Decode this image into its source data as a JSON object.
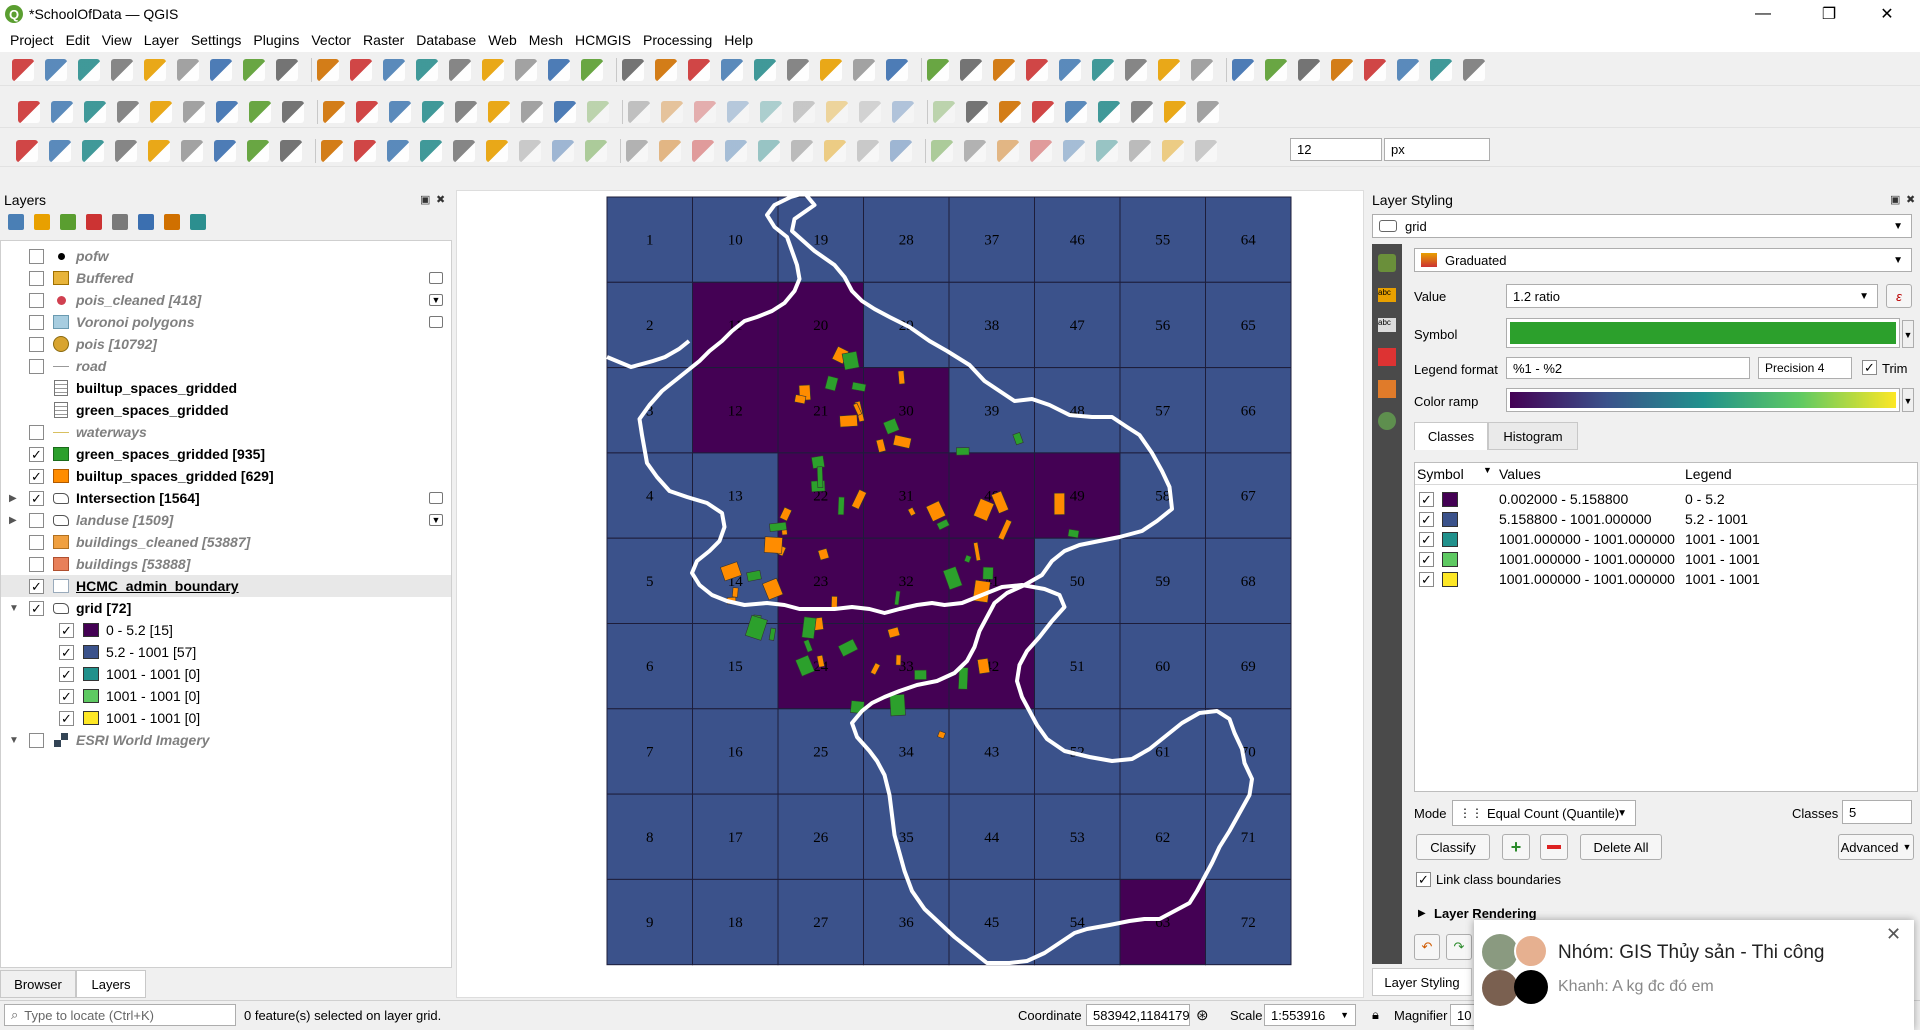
{
  "window": {
    "title": "*SchoolOfData — QGIS",
    "minimize": "—",
    "maximize": "❐",
    "close": "✕"
  },
  "menu": [
    "Project",
    "Edit",
    "View",
    "Layer",
    "Settings",
    "Plugins",
    "Vector",
    "Raster",
    "Database",
    "Web",
    "Mesh",
    "HCMGIS",
    "Processing",
    "Help"
  ],
  "digitize": {
    "size_value": "12",
    "unit": "px"
  },
  "layers_panel": {
    "title": "Layers",
    "items": [
      {
        "label": "pofw",
        "checked": false,
        "style": "it",
        "icon": "dot"
      },
      {
        "label": "Buffered",
        "checked": false,
        "style": "it",
        "icon": "yellow-square"
      },
      {
        "label": "pois_cleaned [418]",
        "checked": false,
        "style": "it",
        "icon": "red-dot"
      },
      {
        "label": "Voronoi polygons",
        "checked": false,
        "style": "it",
        "icon": "lightblue-square"
      },
      {
        "label": "pois [10792]",
        "checked": false,
        "style": "it",
        "icon": "yellow-circle"
      },
      {
        "label": "road",
        "checked": false,
        "style": "it",
        "icon": "line"
      },
      {
        "label": "builtup_spaces_gridded",
        "checked": null,
        "style": "bd",
        "icon": "table"
      },
      {
        "label": "green_spaces_gridded",
        "checked": null,
        "style": "bd",
        "icon": "table"
      },
      {
        "label": "waterways",
        "checked": false,
        "style": "it",
        "icon": "yellow-line"
      },
      {
        "label": "green_spaces_gridded [935]",
        "checked": true,
        "style": "bd",
        "icon": "green-square"
      },
      {
        "label": "builtup_spaces_gridded [629]",
        "checked": true,
        "style": "bd",
        "icon": "orange-square"
      },
      {
        "label": "Intersection [1564]",
        "checked": true,
        "style": "bd",
        "icon": "polygon"
      },
      {
        "label": "landuse [1509]",
        "checked": false,
        "style": "it",
        "icon": "polygon"
      },
      {
        "label": "buildings_cleaned [53887]",
        "checked": false,
        "style": "it",
        "icon": "orange2-square"
      },
      {
        "label": "buildings [53888]",
        "checked": false,
        "style": "it",
        "icon": "salmon-square"
      },
      {
        "label": "HCMC_admin_boundary",
        "checked": true,
        "style": "bd",
        "icon": "empty-square"
      },
      {
        "label": "grid [72]",
        "checked": true,
        "style": "bd",
        "icon": "polygon"
      },
      {
        "label": "0 - 5.2 [15]",
        "checked": true,
        "style": "n",
        "icon": "c1"
      },
      {
        "label": "5.2 - 1001 [57]",
        "checked": true,
        "style": "n",
        "icon": "c2"
      },
      {
        "label": "1001 - 1001 [0]",
        "checked": true,
        "style": "n",
        "icon": "c3"
      },
      {
        "label": "1001 - 1001 [0]",
        "checked": true,
        "style": "n",
        "icon": "c4"
      },
      {
        "label": "1001 - 1001 [0]",
        "checked": true,
        "style": "n",
        "icon": "c5"
      },
      {
        "label": "ESRI World Imagery",
        "checked": false,
        "style": "it",
        "icon": "checker"
      }
    ],
    "bottom_tabs": [
      "Browser",
      "Layers"
    ]
  },
  "colors": {
    "class1": "#440154",
    "class2": "#3b528b",
    "class3": "#21918c",
    "class4": "#5ec962",
    "class5": "#fde725",
    "green": "#2ca02c",
    "orange": "#ff8c00"
  },
  "grid": {
    "dark_cells": [
      11,
      12,
      20,
      21,
      22,
      23,
      24,
      30,
      31,
      32,
      33,
      40,
      41,
      42,
      49,
      63
    ]
  },
  "styling": {
    "title": "Layer Styling",
    "layer": "grid",
    "renderer": "Graduated",
    "value_label": "Value",
    "value": "1.2  ratio",
    "symbol_label": "Symbol",
    "legend_format_label": "Legend format",
    "legend_format": "%1 - %2",
    "precision": "Precision 4",
    "trim": "Trim",
    "color_ramp_label": "Color ramp",
    "tabs": [
      "Classes",
      "Histogram"
    ],
    "headers": [
      "Symbol",
      "Values",
      "Legend"
    ],
    "classes": [
      {
        "values": "0.002000 - 5.158800",
        "legend": "0 - 5.2"
      },
      {
        "values": "5.158800 - 1001.000000",
        "legend": "5.2 - 1001"
      },
      {
        "values": "1001.000000 - 1001.000000",
        "legend": "1001 - 1001"
      },
      {
        "values": "1001.000000 - 1001.000000",
        "legend": "1001 - 1001"
      },
      {
        "values": "1001.000000 - 1001.000000",
        "legend": "1001 - 1001"
      }
    ],
    "mode_label": "Mode",
    "mode": "Equal Count (Quantile)",
    "classes_label": "Classes",
    "classes_count": "5",
    "classify": "Classify",
    "delete_all": "Delete All",
    "advanced": "Advanced",
    "link_boundaries": "Link class boundaries",
    "layer_rendering": "Layer Rendering",
    "bottom_tab": "Layer Styling"
  },
  "status": {
    "locate_placeholder": "Type to locate (Ctrl+K)",
    "selected": "0 feature(s) selected on layer grid.",
    "coord_label": "Coordinate",
    "coord": "583942,1184179",
    "scale_label": "Scale",
    "scale": "1:553916",
    "magnifier_label": "Magnifier",
    "magnifier": "10"
  },
  "notification": {
    "group": "Nhóm: GIS Thủy sản - Thi công",
    "message": "Khanh: A kg đc đó em",
    "close": "✕"
  }
}
